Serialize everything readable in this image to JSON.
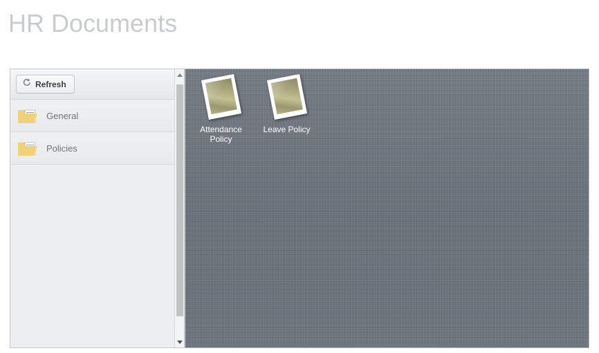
{
  "page": {
    "title": "HR Documents"
  },
  "sidebar": {
    "toolbar": {
      "refresh_label": "Refresh",
      "refresh_icon": "refresh-circular-arrow-icon"
    },
    "items": [
      {
        "label": "General",
        "icon": "folder-document-icon"
      },
      {
        "label": "Policies",
        "icon": "folder-document-icon"
      }
    ],
    "scrollbar": {
      "up_icon": "triangle-up-icon",
      "down_icon": "triangle-down-icon"
    }
  },
  "content": {
    "documents": [
      {
        "label": "Attendance Policy",
        "icon": "document-thumbnail"
      },
      {
        "label": "Leave Policy",
        "icon": "document-thumbnail"
      }
    ]
  },
  "colors": {
    "title": "#c8ccd0",
    "panel_background": "#6e757e",
    "sidebar_background": "#eceef0",
    "item_text": "#6f7478",
    "label_text": "#ffffff"
  }
}
